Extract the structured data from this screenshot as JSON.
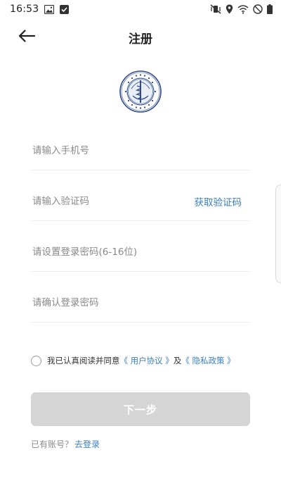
{
  "status_bar": {
    "time": "16:53"
  },
  "header": {
    "title": "注册"
  },
  "form": {
    "phone_placeholder": "请输入手机号",
    "code_placeholder": "请输入验证码",
    "get_code_label": "获取验证码",
    "password_placeholder": "请设置登录密码(6-16位)",
    "confirm_placeholder": "请确认登录密码"
  },
  "agreement": {
    "prefix": "我已认真阅读并同意",
    "user_agreement": "《 用户协议 》",
    "and": "及",
    "privacy_policy": "《 隐私政策 》"
  },
  "next_button_label": "下一步",
  "login_hint": {
    "text": "已有账号？",
    "link": "去登录"
  },
  "colors": {
    "link": "#3a7fc1",
    "button_disabled": "#d5d5d5"
  },
  "icons": {
    "back": "arrow-left-icon",
    "logo": "hospital-logo"
  }
}
